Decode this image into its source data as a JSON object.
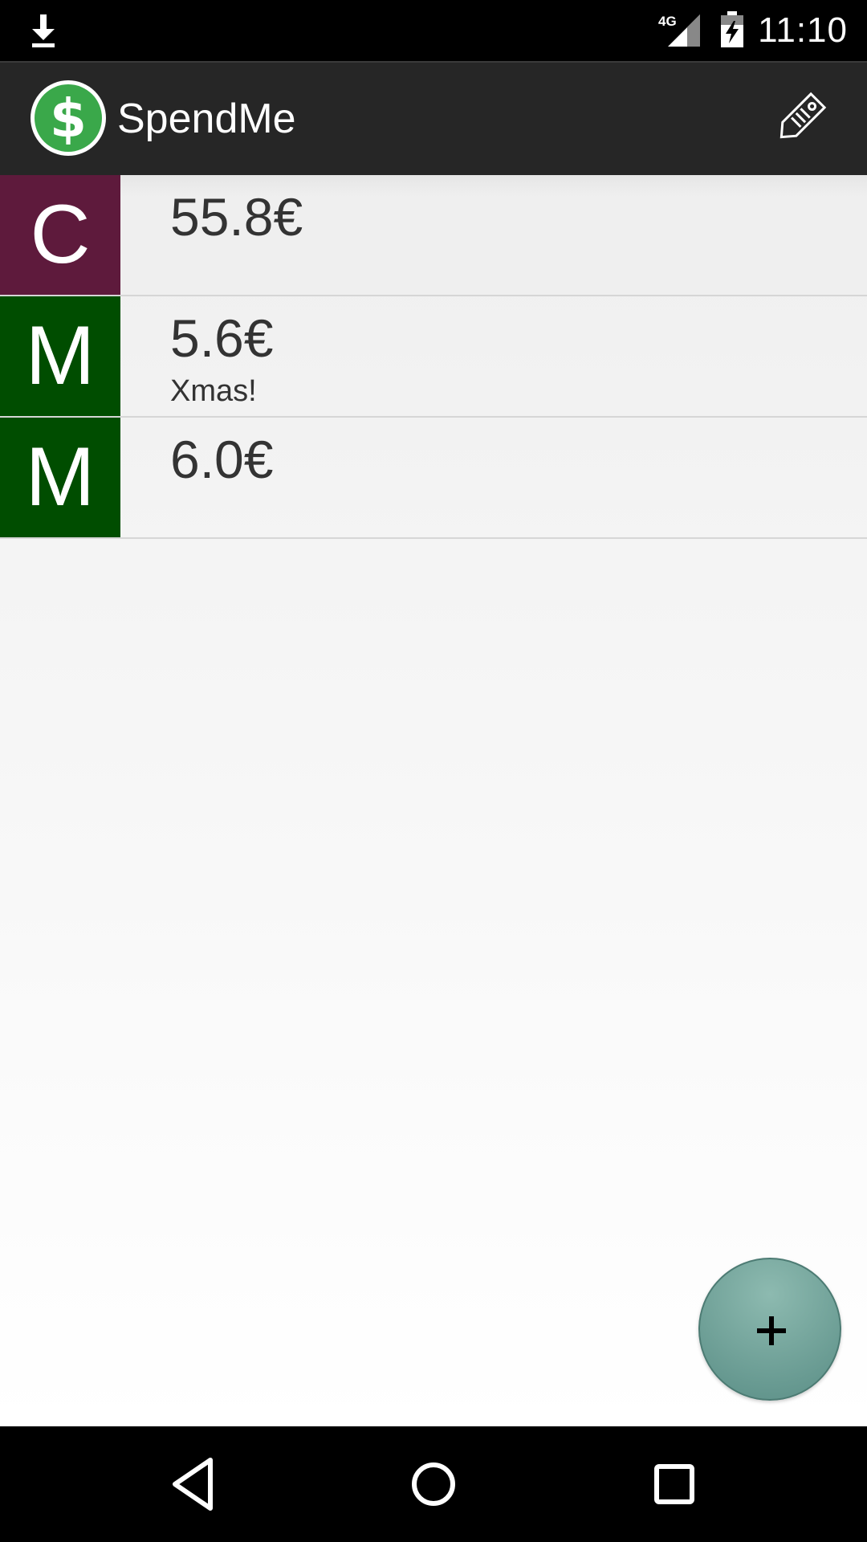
{
  "status_bar": {
    "network": "4G",
    "time": "11:10",
    "icons": [
      "download-icon",
      "signal-icon",
      "battery-charging-icon"
    ]
  },
  "app_bar": {
    "title": "SpendMe",
    "logo_icon": "dollar-logo-icon",
    "action_icon": "tag-icon"
  },
  "expenses": [
    {
      "category_letter": "C",
      "amount": "55.8€",
      "note": "",
      "color": "#5e1a3c"
    },
    {
      "category_letter": "M",
      "amount": "5.6€",
      "note": "Xmas!",
      "color": "#004d00"
    },
    {
      "category_letter": "M",
      "amount": "6.0€",
      "note": "",
      "color": "#004d00"
    }
  ],
  "fab": {
    "icon": "plus-icon"
  },
  "nav_bar": {
    "icons": [
      "back-icon",
      "home-icon",
      "recents-icon"
    ]
  },
  "colors": {
    "app_bar": "#262626",
    "logo_green": "#3aa84a",
    "fab": "#6f9f97"
  }
}
